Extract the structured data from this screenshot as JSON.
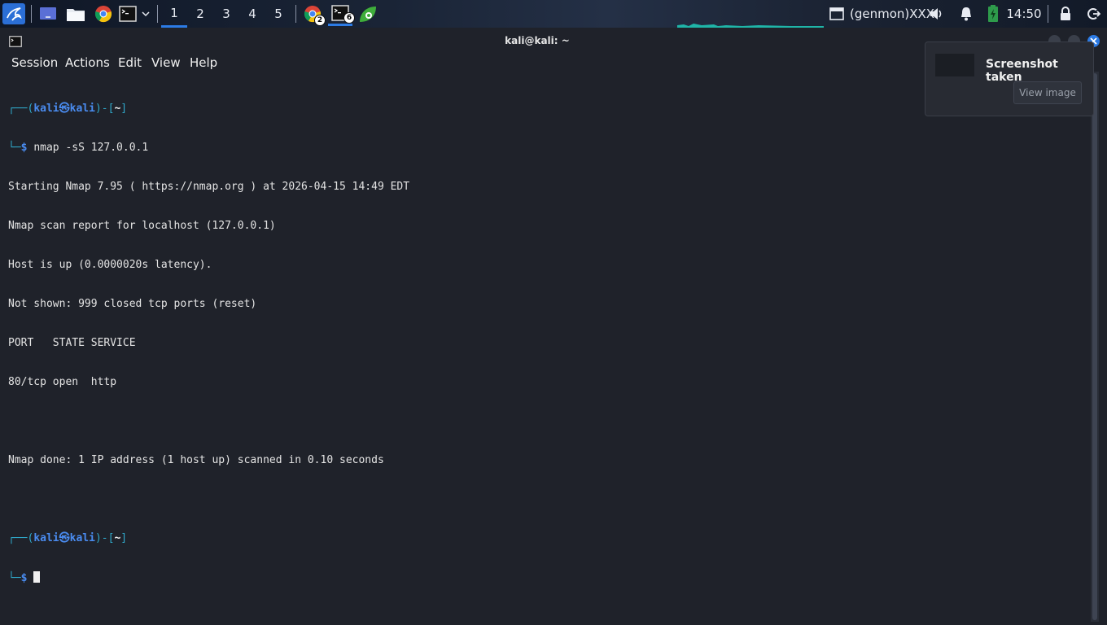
{
  "panel": {
    "workspaces": [
      "1",
      "2",
      "3",
      "4",
      "5"
    ],
    "active_workspace": "1",
    "chrome_badge": "2",
    "terminal_badge": "6",
    "genmon": "(genmon)XXX",
    "clock": "14:50"
  },
  "window": {
    "title": "kali@kali: ~",
    "menu": [
      "Session",
      "Actions",
      "Edit",
      "View",
      "Help"
    ]
  },
  "terminal": {
    "prompt_user": "kali",
    "prompt_at": "㉿",
    "prompt_host": "kali",
    "prompt_dir": "~",
    "command": "nmap -sS 127.0.0.1",
    "output": [
      "Starting Nmap 7.95 ( https://nmap.org ) at 2026-04-15 14:49 EDT",
      "Nmap scan report for localhost (127.0.0.1)",
      "Host is up (0.0000020s latency).",
      "Not shown: 999 closed tcp ports (reset)",
      "PORT   STATE SERVICE",
      "80/tcp open  http",
      "",
      "Nmap done: 1 IP address (1 host up) scanned in 0.10 seconds"
    ]
  },
  "notification": {
    "title": "Screenshot taken",
    "button": "View image"
  },
  "colors": {
    "accent": "#2c7be5",
    "prompt_frame": "#2fa8c9",
    "prompt_user": "#4a8cf0",
    "background": "#1f222a"
  }
}
